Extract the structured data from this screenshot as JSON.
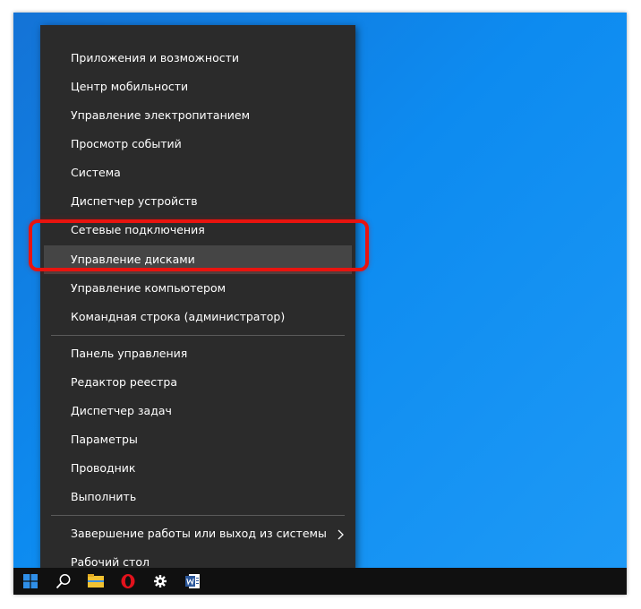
{
  "menu": {
    "items": [
      {
        "label": "Приложения и возможности"
      },
      {
        "label": "Центр мобильности"
      },
      {
        "label": "Управление электропитанием"
      },
      {
        "label": "Просмотр событий"
      },
      {
        "label": "Система"
      },
      {
        "label": "Диспетчер устройств"
      },
      {
        "label": "Сетевые подключения"
      },
      {
        "label": "Управление дисками"
      },
      {
        "label": "Управление компьютером"
      },
      {
        "label": "Командная строка (администратор)"
      },
      {
        "label": "Панель управления"
      },
      {
        "label": "Редактор реестра"
      },
      {
        "label": "Диспетчер задач"
      },
      {
        "label": "Параметры"
      },
      {
        "label": "Проводник"
      },
      {
        "label": "Выполнить"
      },
      {
        "label": "Завершение работы или выход из системы"
      },
      {
        "label": "Рабочий стол"
      }
    ],
    "selected_item": "Управление дисками"
  },
  "taskbar": {
    "buttons": [
      "windows-start-icon",
      "search-icon",
      "file-explorer-icon",
      "opera-icon",
      "settings-gear-icon",
      "word-icon"
    ]
  },
  "colors": {
    "desktop": "#0d8bf0",
    "menu_background": "#2b2b2b",
    "selected_item": "#454545",
    "highlight_frame": "#e8140f",
    "taskbar": "#101010"
  }
}
